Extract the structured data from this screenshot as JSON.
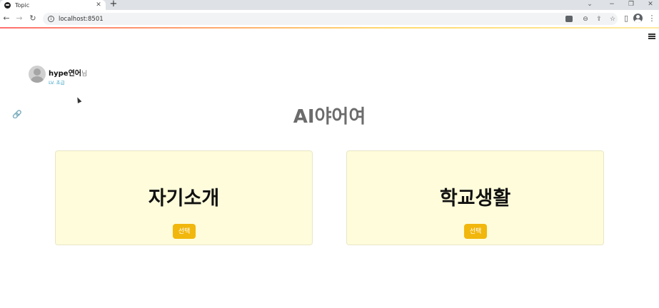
{
  "browser": {
    "tab": {
      "title": "Topic",
      "close": "✕"
    },
    "new_tab": "+",
    "window_controls": {
      "dropdown": "⌄",
      "minimize": "−",
      "restore": "❐",
      "close": "✕"
    },
    "nav": {
      "back": "←",
      "forward": "→",
      "reload": "↻"
    },
    "address": {
      "url": "localhost:8501"
    },
    "toolbar_glyphs": {
      "zoom": "⊖",
      "share": "⇪",
      "bookmark": "☆",
      "sidebar": "▯",
      "menu": "⋮"
    }
  },
  "page": {
    "user": {
      "name": "hype연어",
      "suffix": "님",
      "level": "LV. 초급"
    },
    "link_glyph": "🔗",
    "title": "AI야어여",
    "cards": [
      {
        "title": "자기소개",
        "button": "선택"
      },
      {
        "title": "학교생활",
        "button": "선택"
      }
    ]
  }
}
